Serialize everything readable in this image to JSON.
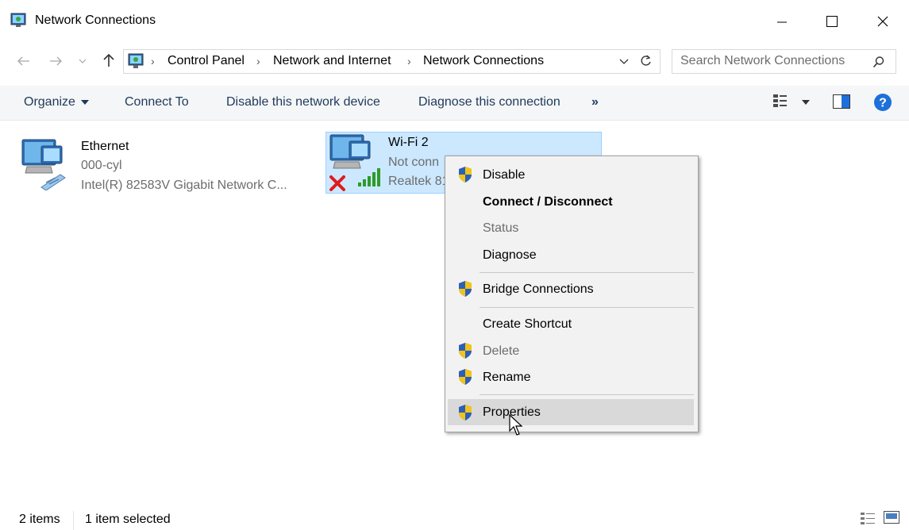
{
  "window": {
    "title": "Network Connections",
    "icons": [
      "network-connections-icon",
      "minimize-icon",
      "maximize-icon",
      "close-icon"
    ]
  },
  "address": {
    "breadcrumbs": [
      "Control Panel",
      "Network and Internet",
      "Network Connections"
    ],
    "search_placeholder": "Search Network Connections",
    "icons": [
      "back-arrow-icon",
      "forward-arrow-icon",
      "recent-dropdown-icon",
      "up-arrow-icon",
      "dropdown-chevron-icon",
      "refresh-icon",
      "search-icon"
    ]
  },
  "toolbar": {
    "organize": "Organize",
    "connect_to": "Connect To",
    "disable_device": "Disable this network device",
    "diagnose": "Diagnose this connection",
    "more": "»",
    "icons": [
      "change-view-icon",
      "preview-pane-icon",
      "help-icon"
    ]
  },
  "connections": [
    {
      "name": "Ethernet",
      "status": "000-cyl",
      "device": "Intel(R) 82583V Gigabit Network C..."
    },
    {
      "name": "Wi-Fi 2",
      "status": "Not conn",
      "device": "Realtek 81"
    }
  ],
  "context_menu": {
    "items": [
      {
        "label": "Disable",
        "shield": true
      },
      {
        "label": "Connect / Disconnect",
        "bold": true
      },
      {
        "label": "Status",
        "disabled": true
      },
      {
        "label": "Diagnose"
      },
      {
        "label": "Bridge Connections",
        "shield": true
      },
      {
        "label": "Create Shortcut"
      },
      {
        "label": "Delete",
        "shield": true,
        "disabled": true
      },
      {
        "label": "Rename",
        "shield": true
      },
      {
        "label": "Properties",
        "shield": true,
        "hovered": true
      }
    ]
  },
  "statusbar": {
    "count": "2 items",
    "selected": "1 item selected"
  },
  "colors": {
    "selection_fill": "#cce8ff",
    "selection_border": "#99d1ff",
    "toolbar_text": "#1e395b",
    "help_blue": "#1e6fd9"
  }
}
